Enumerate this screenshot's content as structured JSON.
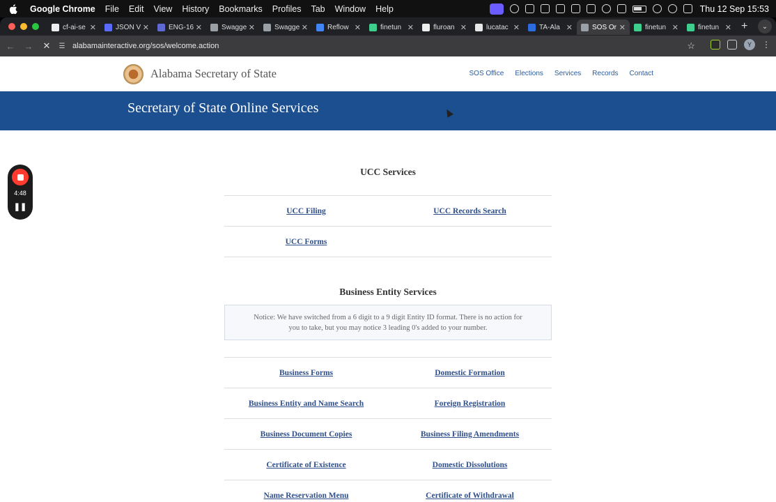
{
  "menubar": {
    "app_name": "Google Chrome",
    "items": [
      "File",
      "Edit",
      "View",
      "History",
      "Bookmarks",
      "Profiles",
      "Tab",
      "Window",
      "Help"
    ],
    "clock": "Thu 12 Sep  15:53"
  },
  "tabs": [
    {
      "label": "cf-ai-se",
      "color": "#eeeeee"
    },
    {
      "label": "JSON V",
      "color": "#5a6cff"
    },
    {
      "label": "ENG-16",
      "color": "#5e6ad2"
    },
    {
      "label": "Swagge",
      "color": "#9aa0a6"
    },
    {
      "label": "Swagge",
      "color": "#9aa0a6"
    },
    {
      "label": "Reflow",
      "color": "#4285f4"
    },
    {
      "label": "finetun",
      "color": "#3ecf8e"
    },
    {
      "label": "fluroan",
      "color": "#eeeeee"
    },
    {
      "label": "lucatac",
      "color": "#e8e8e8"
    },
    {
      "label": "TA-Ala",
      "color": "#2d6cdf"
    },
    {
      "label": "SOS Or",
      "color": "#9aa0a6",
      "active": true
    },
    {
      "label": "finetun",
      "color": "#3ecf8e"
    },
    {
      "label": "finetun",
      "color": "#3ecf8e"
    }
  ],
  "browser": {
    "url": "alabamainteractive.org/sos/welcome.action",
    "avatar_letter": "Y"
  },
  "site": {
    "title": "Alabama Secretary of State",
    "nav": [
      "SOS Office",
      "Elections",
      "Services",
      "Records",
      "Contact"
    ],
    "banner_title": "Secretary of State Online Services"
  },
  "ucc": {
    "heading": "UCC Services",
    "rows": [
      [
        "UCC Filing",
        "UCC Records Search"
      ],
      [
        "UCC Forms",
        ""
      ]
    ]
  },
  "business": {
    "heading": "Business Entity Services",
    "notice_line1": "Notice: We have switched from a 6 digit to a 9 digit Entity ID format. There is no action for",
    "notice_line2": "you to take, but you may notice 3 leading 0's added to your number.",
    "rows": [
      [
        "Business Forms",
        "Domestic Formation"
      ],
      [
        "Business Entity and Name Search",
        "Foreign Registration"
      ],
      [
        "Business Document Copies",
        "Business Filing Amendments"
      ],
      [
        "Certificate of Existence",
        "Domestic Dissolutions"
      ],
      [
        "Name Reservation Menu",
        "Certificate of Withdrawal"
      ]
    ]
  },
  "recorder": {
    "time": "4:48"
  }
}
